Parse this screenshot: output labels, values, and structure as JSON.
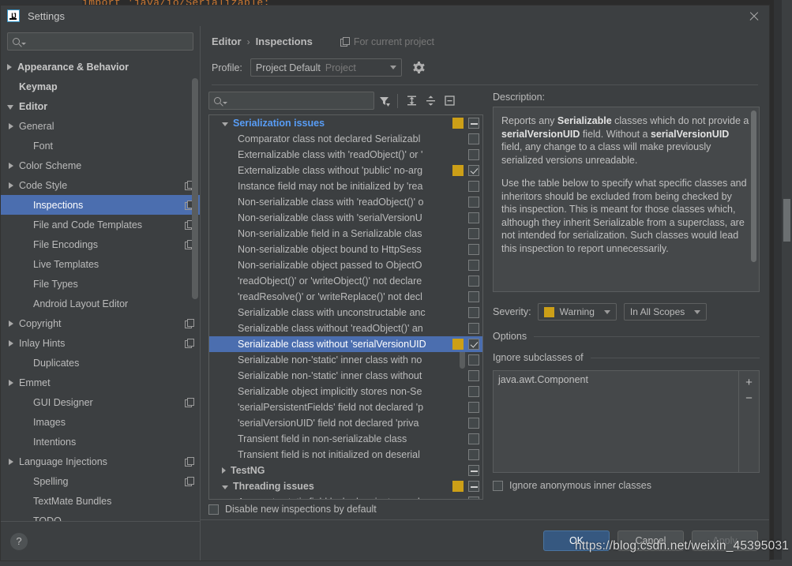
{
  "editor_background": {
    "code_line": "import 'java/io/Serializable;"
  },
  "window": {
    "title": "Settings",
    "logo_text": "IJ",
    "close_icon": "close-icon"
  },
  "sidebar": {
    "search_placeholder": "",
    "search_value": "",
    "items": [
      {
        "label": "Appearance & Behavior",
        "arrow": "right",
        "bold": true,
        "indent": 0,
        "copy": false,
        "selected": false
      },
      {
        "label": "Keymap",
        "arrow": "none",
        "bold": true,
        "indent": 1,
        "copy": false,
        "selected": false
      },
      {
        "label": "Editor",
        "arrow": "down",
        "bold": true,
        "indent": 0,
        "copy": false,
        "selected": false
      },
      {
        "label": "General",
        "arrow": "right",
        "bold": false,
        "indent": 1,
        "copy": false,
        "selected": false
      },
      {
        "label": "Font",
        "arrow": "none",
        "bold": false,
        "indent": 2,
        "copy": false,
        "selected": false
      },
      {
        "label": "Color Scheme",
        "arrow": "right",
        "bold": false,
        "indent": 1,
        "copy": false,
        "selected": false
      },
      {
        "label": "Code Style",
        "arrow": "right",
        "bold": false,
        "indent": 1,
        "copy": true,
        "selected": false
      },
      {
        "label": "Inspections",
        "arrow": "none",
        "bold": false,
        "indent": 2,
        "copy": true,
        "selected": true
      },
      {
        "label": "File and Code Templates",
        "arrow": "none",
        "bold": false,
        "indent": 2,
        "copy": true,
        "selected": false
      },
      {
        "label": "File Encodings",
        "arrow": "none",
        "bold": false,
        "indent": 2,
        "copy": true,
        "selected": false
      },
      {
        "label": "Live Templates",
        "arrow": "none",
        "bold": false,
        "indent": 2,
        "copy": false,
        "selected": false
      },
      {
        "label": "File Types",
        "arrow": "none",
        "bold": false,
        "indent": 2,
        "copy": false,
        "selected": false
      },
      {
        "label": "Android Layout Editor",
        "arrow": "none",
        "bold": false,
        "indent": 2,
        "copy": false,
        "selected": false
      },
      {
        "label": "Copyright",
        "arrow": "right",
        "bold": false,
        "indent": 1,
        "copy": true,
        "selected": false
      },
      {
        "label": "Inlay Hints",
        "arrow": "right",
        "bold": false,
        "indent": 1,
        "copy": true,
        "selected": false
      },
      {
        "label": "Duplicates",
        "arrow": "none",
        "bold": false,
        "indent": 2,
        "copy": false,
        "selected": false
      },
      {
        "label": "Emmet",
        "arrow": "right",
        "bold": false,
        "indent": 1,
        "copy": false,
        "selected": false
      },
      {
        "label": "GUI Designer",
        "arrow": "none",
        "bold": false,
        "indent": 2,
        "copy": true,
        "selected": false
      },
      {
        "label": "Images",
        "arrow": "none",
        "bold": false,
        "indent": 2,
        "copy": false,
        "selected": false
      },
      {
        "label": "Intentions",
        "arrow": "none",
        "bold": false,
        "indent": 2,
        "copy": false,
        "selected": false
      },
      {
        "label": "Language Injections",
        "arrow": "right",
        "bold": false,
        "indent": 1,
        "copy": true,
        "selected": false
      },
      {
        "label": "Spelling",
        "arrow": "none",
        "bold": false,
        "indent": 2,
        "copy": true,
        "selected": false
      },
      {
        "label": "TextMate Bundles",
        "arrow": "none",
        "bold": false,
        "indent": 2,
        "copy": false,
        "selected": false
      },
      {
        "label": "TODO",
        "arrow": "none",
        "bold": false,
        "indent": 2,
        "copy": false,
        "selected": false
      }
    ],
    "help_label": "?"
  },
  "header": {
    "breadcrumb_parent": "Editor",
    "breadcrumb_sep": "›",
    "breadcrumb_current": "Inspections",
    "for_current_project": "For current project",
    "profile_label": "Profile:",
    "profile_value": "Project Default",
    "profile_scope": "Project",
    "gear_icon": "gear-icon"
  },
  "inspections_toolbar": {
    "search_value": "",
    "filter_icon": "filter-icon",
    "expand_all_icon": "expand-all-icon",
    "collapse_all_icon": "collapse-all-icon",
    "reset_icon": "reset-icon"
  },
  "inspections_tree": {
    "rows": [
      {
        "label": "Serialization issues",
        "type": "group",
        "arrow": "down",
        "blue": true,
        "severity": true,
        "check": "mixed",
        "selected": false
      },
      {
        "label": "Comparator class not declared Serializabl",
        "type": "leaf",
        "check": "empty",
        "selected": false
      },
      {
        "label": "Externalizable class with 'readObject()' or '",
        "type": "leaf",
        "check": "empty",
        "selected": false
      },
      {
        "label": "Externalizable class without 'public' no-arg",
        "type": "leaf",
        "severity": true,
        "check": "checked",
        "selected": false
      },
      {
        "label": "Instance field may not be initialized by 'rea",
        "type": "leaf",
        "check": "empty",
        "selected": false
      },
      {
        "label": "Non-serializable class with 'readObject()' o",
        "type": "leaf",
        "check": "empty",
        "selected": false
      },
      {
        "label": "Non-serializable class with 'serialVersionU",
        "type": "leaf",
        "check": "empty",
        "selected": false
      },
      {
        "label": "Non-serializable field in a Serializable clas",
        "type": "leaf",
        "check": "empty",
        "selected": false
      },
      {
        "label": "Non-serializable object bound to HttpSess",
        "type": "leaf",
        "check": "empty",
        "selected": false
      },
      {
        "label": "Non-serializable object passed to ObjectO",
        "type": "leaf",
        "check": "empty",
        "selected": false
      },
      {
        "label": "'readObject()' or 'writeObject()' not declare",
        "type": "leaf",
        "check": "empty",
        "selected": false
      },
      {
        "label": "'readResolve()' or 'writeReplace()' not decl",
        "type": "leaf",
        "check": "empty",
        "selected": false
      },
      {
        "label": "Serializable class with unconstructable anc",
        "type": "leaf",
        "check": "empty",
        "selected": false
      },
      {
        "label": "Serializable class without 'readObject()' an",
        "type": "leaf",
        "check": "empty",
        "selected": false
      },
      {
        "label": "Serializable class without 'serialVersionUID",
        "type": "leaf",
        "severity": true,
        "check": "checked",
        "selected": true
      },
      {
        "label": "Serializable non-'static' inner class with no",
        "type": "leaf",
        "check": "empty",
        "selected": false
      },
      {
        "label": "Serializable non-'static' inner class without",
        "type": "leaf",
        "check": "empty",
        "selected": false
      },
      {
        "label": "Serializable object implicitly stores non-Se",
        "type": "leaf",
        "check": "empty",
        "selected": false
      },
      {
        "label": "'serialPersistentFields' field not declared 'p",
        "type": "leaf",
        "check": "empty",
        "selected": false
      },
      {
        "label": "'serialVersionUID' field not declared 'priva",
        "type": "leaf",
        "check": "empty",
        "selected": false
      },
      {
        "label": "Transient field in non-serializable class",
        "type": "leaf",
        "check": "empty",
        "selected": false
      },
      {
        "label": "Transient field is not initialized on deserial",
        "type": "leaf",
        "check": "empty",
        "selected": false
      },
      {
        "label": "TestNG",
        "type": "group",
        "arrow": "right",
        "blue": false,
        "check": "mixed",
        "selected": false
      },
      {
        "label": "Threading issues",
        "type": "group",
        "arrow": "down",
        "blue": false,
        "severity": true,
        "check": "mixed",
        "selected": false
      },
      {
        "label": "Access to static field locked on instance d",
        "type": "leaf",
        "check": "empty",
        "selected": false
      }
    ]
  },
  "description": {
    "label": "Description:",
    "paragraph1_prefix": "Reports any ",
    "paragraph1_b1": "Serializable",
    "paragraph1_mid1": " classes which do not provide a ",
    "paragraph1_b2": "serialVersionUID",
    "paragraph1_mid2": " field. Without a ",
    "paragraph1_b3": "serialVersionUID",
    "paragraph1_tail": " field, any change to a class will make previously serialized versions unreadable.",
    "paragraph2": "Use the table below to specify what specific classes and inheritors should be excluded from being checked by this inspection. This is meant for those classes which, although they inherit Serializable from a superclass, are not intended for serialization. Such classes would lead this inspection to report unnecessarily."
  },
  "options": {
    "severity_label": "Severity:",
    "severity_value": "Warning",
    "severity_color": "#cc9f17",
    "scope_value": "In All Scopes",
    "options_title": "Options",
    "ignore_subclasses_title": "Ignore subclasses of",
    "list_items": [
      "java.awt.Component"
    ],
    "add_button": "+",
    "remove_button": "−",
    "ignore_anon_label": "Ignore anonymous inner classes",
    "ignore_anon_checked": false
  },
  "footer": {
    "disable_new_label": "Disable new inspections by default",
    "disable_new_checked": false,
    "ok_label": "OK",
    "cancel_label": "Cancel",
    "apply_label": "Apply"
  },
  "watermark": {
    "text": "https://blog.csdn.net/weixin_45395031"
  },
  "colors": {
    "accent_selection": "#4b6eaf",
    "primary_button": "#365880",
    "warning_swatch": "#cc9f17",
    "group_blue": "#589df6",
    "panel_bg": "#3c3f41",
    "field_bg": "#45484a"
  }
}
